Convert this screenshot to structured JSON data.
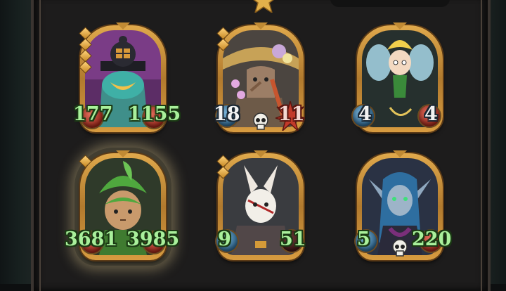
{
  "cards": [
    {
      "id": "diver-golem",
      "attack": "177",
      "health": "1155",
      "buffed": true
    },
    {
      "id": "scarecrow-witch",
      "attack": "18",
      "health": "11",
      "buffed": false
    },
    {
      "id": "fairy",
      "attack": "4",
      "health": "4",
      "buffed": false
    },
    {
      "id": "leaf-sprout",
      "attack": "3681",
      "health": "3985",
      "buffed": true,
      "selected": true
    },
    {
      "id": "rabbit-mask",
      "attack": "9",
      "health": "51",
      "buffed": true
    },
    {
      "id": "blue-elf",
      "attack": "5",
      "health": "220",
      "buffed": true
    }
  ],
  "colors": {
    "stat_buffed": "#a9f09b",
    "frame_gold": "#d79b40",
    "attack_orb": "#2c5f84",
    "health_orb": "#8c2418"
  }
}
